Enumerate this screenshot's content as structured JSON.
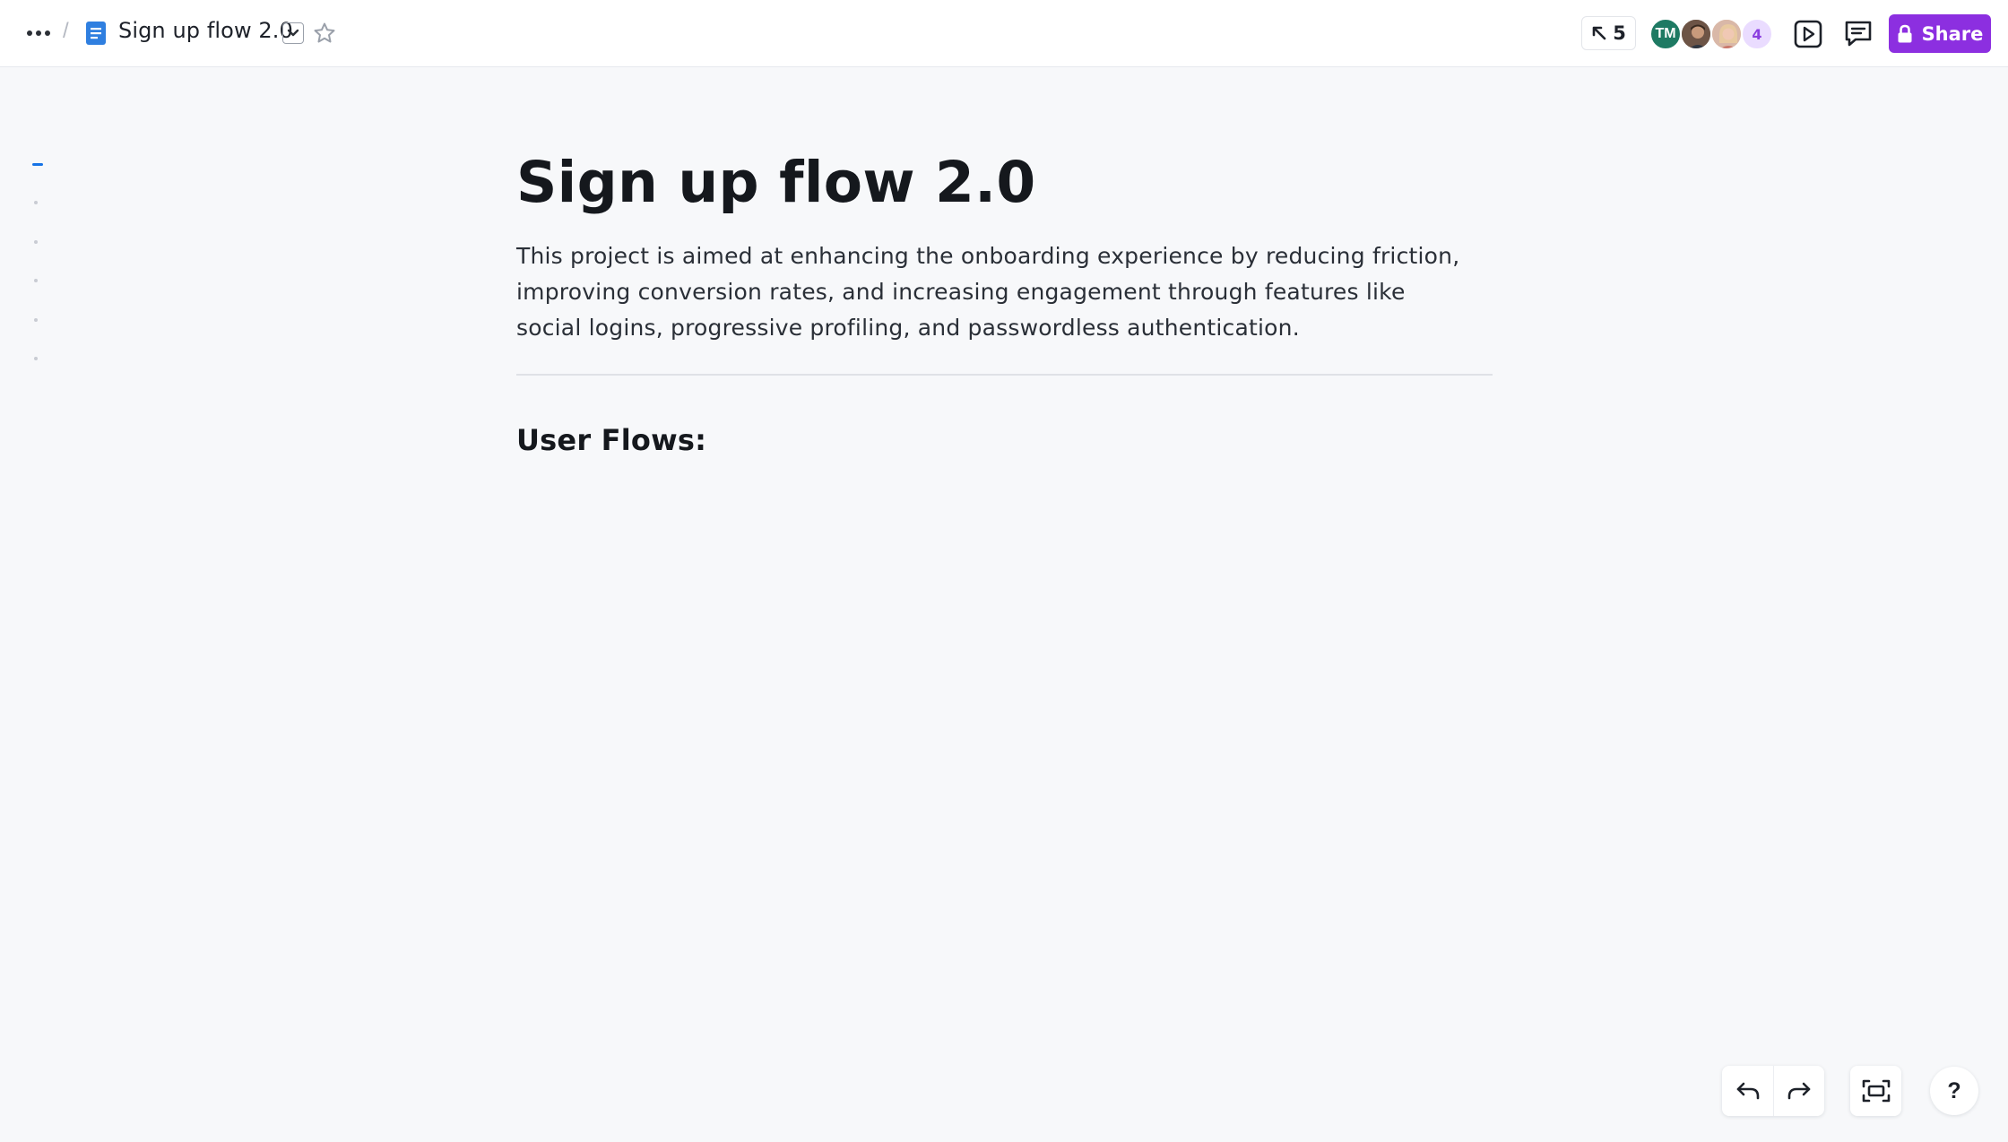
{
  "header": {
    "menu_icon": "more-horizontal-icon",
    "breadcrumb_separator": "/",
    "doc_icon": "document-icon",
    "doc_title": "Sign up flow 2.0",
    "dropdown_icon": "chevron-down-icon",
    "star_icon": "star-outline-icon",
    "cursor_count": "5",
    "collaborators": {
      "initials_avatar": "TM",
      "more_count": "4"
    },
    "present_icon": "play-icon",
    "comment_icon": "comment-icon",
    "share_label": "Share",
    "share_icon": "lock-icon",
    "colors": {
      "accent": "#8c2fe0",
      "avatar_tm": "#1e7a63",
      "outline_active": "#1673e6"
    }
  },
  "document": {
    "title": "Sign up flow 2.0",
    "description": "This project is aimed at enhancing the onboarding experience by reducing friction, improving conversion rates, and increasing engagement through features like social logins, progressive profiling, and passwordless authentication.",
    "section_heading": "User Flows:"
  },
  "controls": {
    "undo_icon": "undo-icon",
    "redo_icon": "redo-icon",
    "fit_icon": "fit-to-screen-icon",
    "help_label": "?"
  }
}
